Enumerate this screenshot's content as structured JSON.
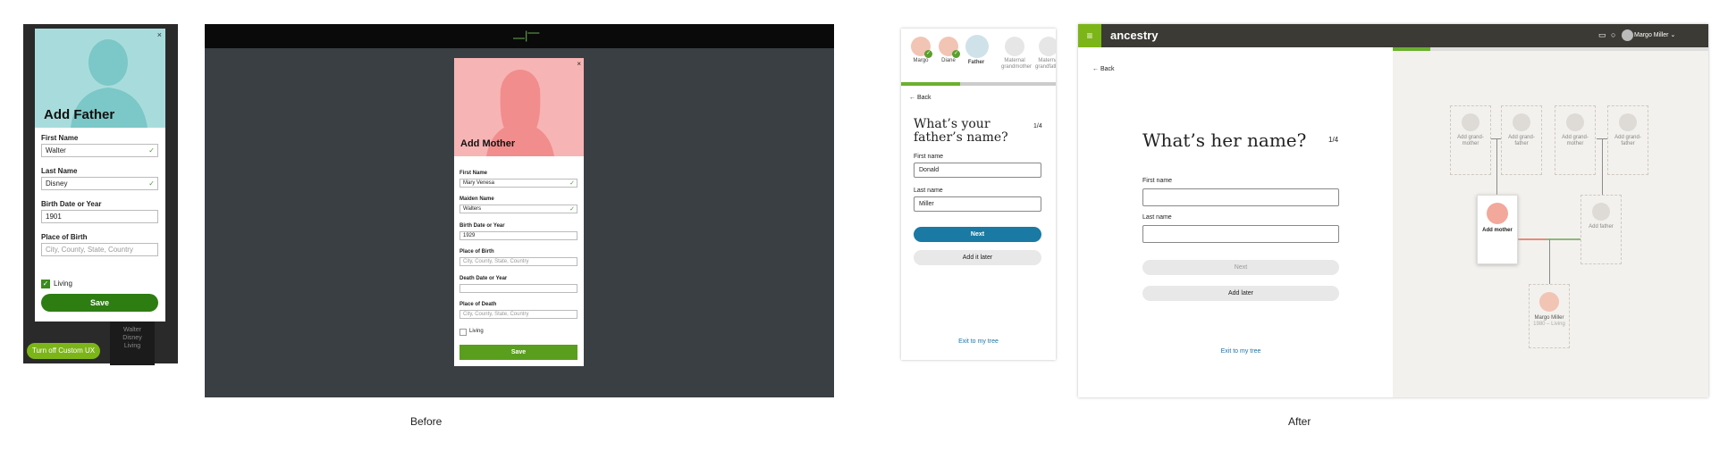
{
  "before_mobile": {
    "close_glyph": "×",
    "title": "Add Father",
    "fields": [
      {
        "label": "First Name",
        "value": "Walter"
      },
      {
        "label": "Last Name",
        "value": "Disney"
      },
      {
        "label": "Birth Date or Year",
        "value": "1901"
      },
      {
        "label": "Place of Birth",
        "placeholder": "City, County, State, Country"
      }
    ],
    "living_label": "Living",
    "save_label": "Save",
    "background_card": [
      "Walter",
      "Disney",
      "Living"
    ],
    "toggle_label": "Turn off Custom UX"
  },
  "before_desktop": {
    "logo": "⎼|⎻",
    "close_glyph": "×",
    "title": "Add Mother",
    "fields": [
      {
        "label": "First Name",
        "value": "Mary Venesa"
      },
      {
        "label": "Maiden Name",
        "value": "Walters"
      },
      {
        "label": "Birth Date or Year",
        "value": "1929"
      },
      {
        "label": "Place of Birth",
        "placeholder": "City, County, State, Country"
      },
      {
        "label": "Death Date or Year",
        "value": ""
      },
      {
        "label": "Place of Death",
        "placeholder": "City, County, State, Country"
      }
    ],
    "living_label": "Living",
    "save_label": "Save"
  },
  "captions": {
    "before": "Before",
    "after": "After"
  },
  "after_mobile": {
    "people": [
      "Margo",
      "Diane",
      "Father",
      "Maternal grandmother",
      "Maternal grandfather"
    ],
    "progress": 0.38,
    "back_label": "← Back",
    "question": "What’s your father’s name?",
    "step": "1/4",
    "first_name_label": "First name",
    "first_name_value": "Donald",
    "last_name_label": "Last name",
    "last_name_value": "Miller",
    "next_label": "Next",
    "later_label": "Add it later",
    "exit_label": "Exit to my tree",
    "colors": {
      "next": "#1a7aa3",
      "progress": "#6bb02e"
    }
  },
  "after_desktop": {
    "brand": "ancestry",
    "user_name": "Margo Miller ⌄",
    "progress": 0.12,
    "back_label": "← Back",
    "question": "What’s her name?",
    "step": "1/4",
    "first_name_label": "First name",
    "last_name_label": "Last name",
    "next_label": "Next",
    "later_label": "Add later",
    "exit_label": "Exit to my tree",
    "tree": {
      "grandparents": [
        "Add grand-mother",
        "Add grand-father",
        "Add grand-mother",
        "Add grand-father"
      ],
      "add_mother": "Add mother",
      "add_father": "Add father",
      "self_name": "Margo Miller",
      "self_years": "1980 – Living"
    },
    "colors": {
      "menu": "#7cb518",
      "nav": "#3b3a35"
    }
  }
}
